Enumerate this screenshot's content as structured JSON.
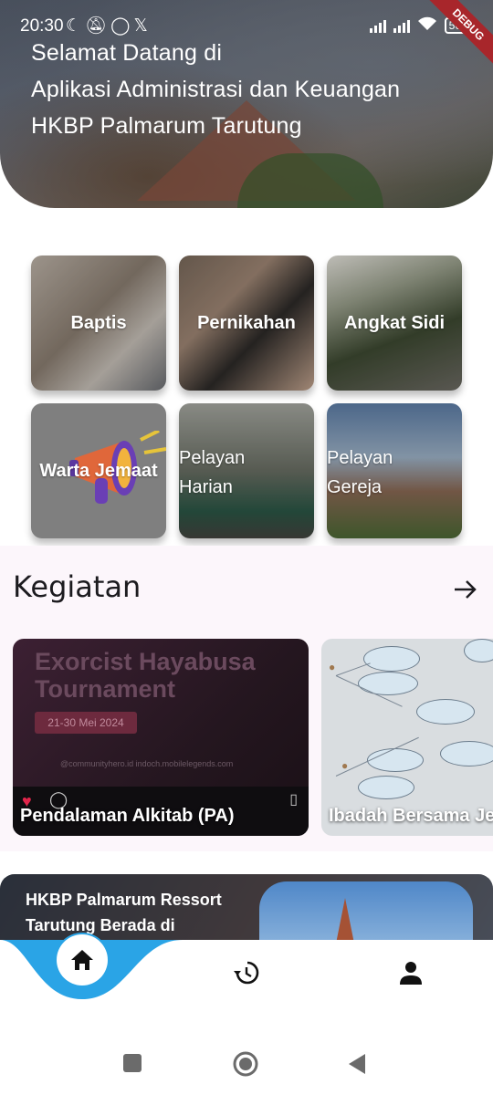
{
  "status_bar": {
    "time": "20:30",
    "battery": "56",
    "debug_label": "DEBUG"
  },
  "header": {
    "title_lines": [
      "Selamat Datang di",
      "Aplikasi Administrasi dan Keuangan",
      "HKBP Palmarum Tarutung"
    ]
  },
  "menu": {
    "items": [
      {
        "label": "Baptis"
      },
      {
        "label": "Pernikahan"
      },
      {
        "label": "Angkat Sidi"
      },
      {
        "label": "Warta Jemaat"
      },
      {
        "label": "Pelayan Harian"
      },
      {
        "label": "Pelayan Gereja"
      }
    ]
  },
  "kegiatan": {
    "title": "Kegiatan",
    "arrow_icon": "arrow-right-icon",
    "cards": [
      {
        "label": "Pendalaman Alkitab (PA)",
        "poster_title": "Exorcist Hayabusa Tournament",
        "poster_date": "21-30 Mei 2024",
        "poster_links": "@communityhero.id   indoch.mobilelegends.com"
      },
      {
        "label": "Ibadah Bersama Je"
      }
    ]
  },
  "info": {
    "lines": [
      "HKBP Palmarum Ressort",
      "Tarutung Berada di"
    ]
  },
  "bottom_nav": {
    "items": [
      "home-icon",
      "history-icon",
      "person-icon"
    ],
    "accent": "#2aa4e6"
  },
  "system_nav": {
    "items": [
      "square-icon",
      "circle-icon",
      "back-triangle-icon"
    ]
  }
}
